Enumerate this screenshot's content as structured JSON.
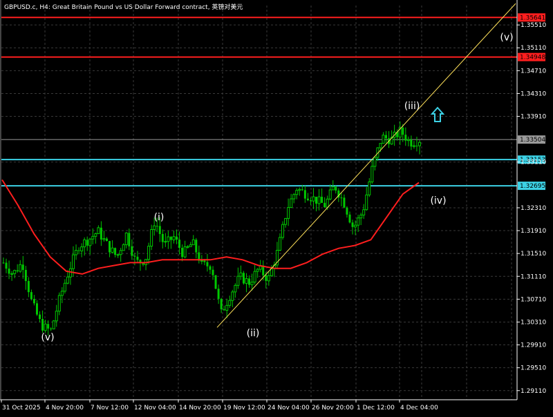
{
  "window": {
    "symbol_title": "GBPUSD.c, H4:  Great Britain Pound vs US Dollar Forward contract, 英镑对美元"
  },
  "colors": {
    "background": "#000000",
    "grid": "#3a3a3a",
    "axis": "#ffffff",
    "bull_candle": "#00c800",
    "bear_candle": "#00c800",
    "moving_average": "#ff1e1e",
    "resistance_line": "#ff1e1e",
    "support_line": "#3cd2e6",
    "current_price_line": "#9a9a9a",
    "trendline": "#ffe15a",
    "arrow": "#3cd2e6",
    "label_text": "#ffffff"
  },
  "chart_data": {
    "type": "candlestick",
    "ylim": [
      1.2895,
      1.3585
    ],
    "y_ticks": [
      "1.35510",
      "1.35110",
      "1.34710",
      "1.34310",
      "1.33910",
      "1.33110",
      "1.32310",
      "1.31910",
      "1.31510",
      "1.31110",
      "1.30710",
      "1.30310",
      "1.29910",
      "1.29510",
      "1.29110"
    ],
    "x_ticks": [
      "31 Oct 2025",
      "4 Nov 20:00",
      "7 Nov 12:00",
      "12 Nov 04:00",
      "14 Nov 20:00",
      "19 Nov 12:00",
      "24 Nov 04:00",
      "26 Nov 20:00",
      "1 Dec 12:00",
      "4 Dec 04:00"
    ],
    "horizontal_lines": [
      {
        "kind": "resistance",
        "value": 1.35641,
        "label": "1.35641"
      },
      {
        "kind": "resistance",
        "value": 1.34948,
        "label": "1.34948"
      },
      {
        "kind": "current",
        "value": 1.33504,
        "label": "1.33504"
      },
      {
        "kind": "support",
        "value": 1.33153,
        "label": "1.33153"
      },
      {
        "kind": "support",
        "value": 1.32695,
        "label": "1.32695"
      }
    ],
    "price_anchors": [
      1.3135,
      1.3115,
      1.3135,
      1.3065,
      1.3025,
      1.3015,
      1.3075,
      1.3125,
      1.3165,
      1.3175,
      1.319,
      1.3165,
      1.3145,
      1.3185,
      1.3135,
      1.314,
      1.321,
      1.3165,
      1.318,
      1.315,
      1.317,
      1.313,
      1.313,
      1.3045,
      1.308,
      1.311,
      1.31,
      1.3125,
      1.3105,
      1.3155,
      1.323,
      1.3265,
      1.3255,
      1.3245,
      1.3235,
      1.327,
      1.324,
      1.3195,
      1.3225,
      1.33,
      1.3355,
      1.335,
      1.3365,
      1.3345,
      1.335
    ],
    "moving_average": [
      1.328,
      1.3235,
      1.3185,
      1.3145,
      1.312,
      1.3115,
      1.3125,
      1.313,
      1.3135,
      1.3135,
      1.314,
      1.314,
      1.314,
      1.314,
      1.3145,
      1.314,
      1.313,
      1.3125,
      1.3125,
      1.3135,
      1.315,
      1.316,
      1.3165,
      1.3175,
      1.3215,
      1.3255,
      1.3275
    ],
    "trendline": {
      "from": {
        "x": "19 Nov 12:00",
        "y": 1.3032
      },
      "to": {
        "x": "4 Dec 04:00",
        "y": 1.3368
      }
    },
    "wave_labels": [
      {
        "text": "(v)",
        "y": 1.3005
      },
      {
        "text": "(i)",
        "y": 1.3215
      },
      {
        "text": "(ii)",
        "y": 1.3012
      },
      {
        "text": "(iii)",
        "y": 1.341
      },
      {
        "text": "(iv)",
        "y": 1.3244
      },
      {
        "text": "(v)",
        "y": 1.353
      }
    ],
    "arrow": {
      "direction": "up",
      "icon": "hollow-up-arrow-icon"
    }
  }
}
